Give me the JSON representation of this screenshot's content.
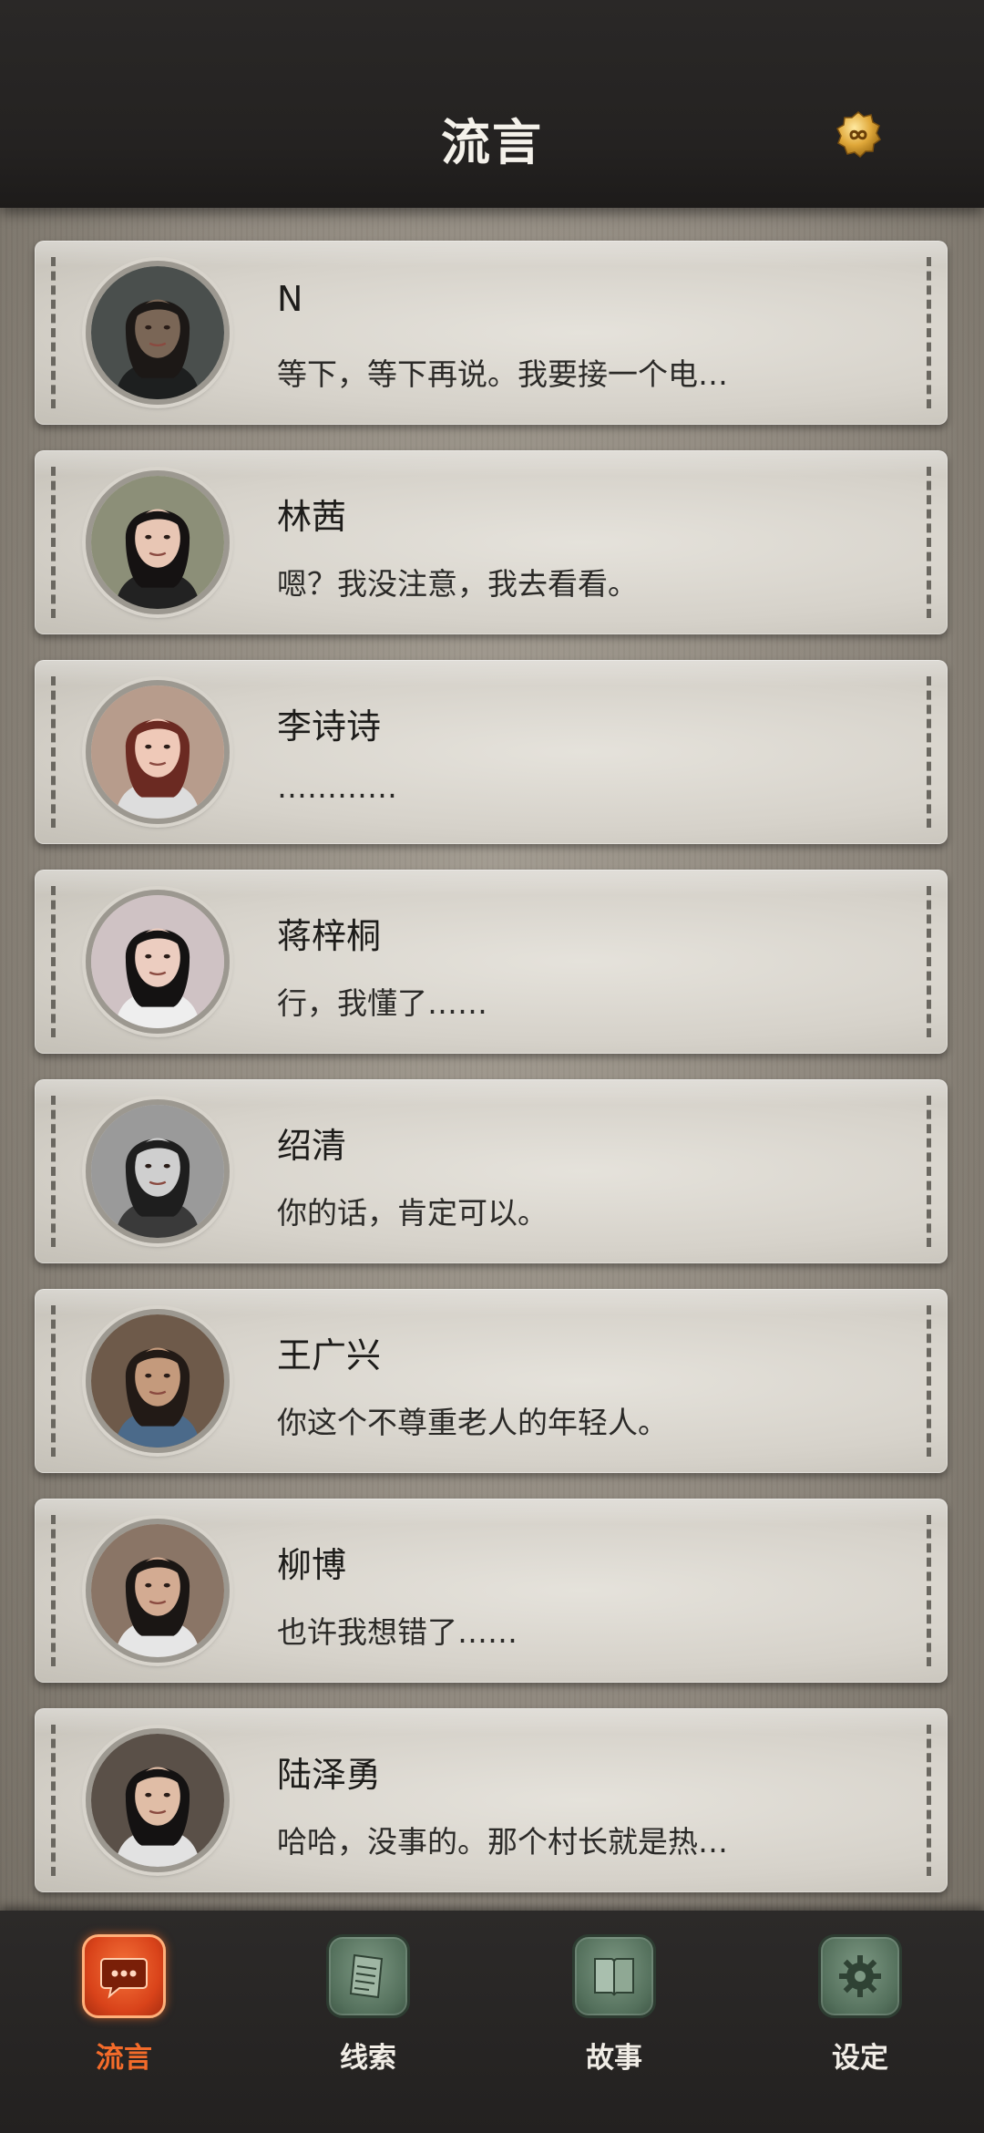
{
  "header": {
    "title": "流言",
    "badge_icon": "infinity-badge-icon"
  },
  "conversations": [
    {
      "name": "N",
      "message": "等下，等下再说。我要接一个电…",
      "avatar": {
        "skin": "#7a6656",
        "hair": "#1c1816",
        "shirt": "#1d1f1f",
        "bg": "#4a4f4d"
      }
    },
    {
      "name": "林茜",
      "message": "嗯？我没注意，我去看看。",
      "avatar": {
        "skin": "#e8c6b4",
        "hair": "#151212",
        "shirt": "#222",
        "bg": "#8c8f78"
      }
    },
    {
      "name": "李诗诗",
      "message": "…………",
      "avatar": {
        "skin": "#efc9b8",
        "hair": "#6b2a22",
        "shirt": "#ddd",
        "bg": "#b79c8c"
      }
    },
    {
      "name": "蒋梓桐",
      "message": "行，我懂了……",
      "avatar": {
        "skin": "#eccdc0",
        "hair": "#141212",
        "shirt": "#eee",
        "bg": "#cfc2c4"
      }
    },
    {
      "name": "绍清",
      "message": "你的话，肯定可以。",
      "avatar": {
        "skin": "#cfcfcf",
        "hair": "#1e1e1e",
        "shirt": "#3a3a3a",
        "bg": "#9a9a9a"
      }
    },
    {
      "name": "王广兴",
      "message": "你这个不尊重老人的年轻人。",
      "avatar": {
        "skin": "#c49a7c",
        "hair": "#221a16",
        "shirt": "#4b6a8a",
        "bg": "#6e5a4a"
      }
    },
    {
      "name": "柳博",
      "message": "也许我想错了……",
      "avatar": {
        "skin": "#d3ab92",
        "hair": "#1a1614",
        "shirt": "#e6e6e6",
        "bg": "#8a7566"
      }
    },
    {
      "name": "陆泽勇",
      "message": "哈哈，没事的。那个村长就是热…",
      "avatar": {
        "skin": "#e0bda6",
        "hair": "#141212",
        "shirt": "#e2e2e2",
        "bg": "#5a5048"
      }
    }
  ],
  "bottom_nav": {
    "items": [
      {
        "label": "流言",
        "icon": "chat-bubble-icon",
        "active": true
      },
      {
        "label": "线索",
        "icon": "paper-scroll-icon",
        "active": false
      },
      {
        "label": "故事",
        "icon": "book-icon",
        "active": false
      },
      {
        "label": "设定",
        "icon": "gear-icon",
        "active": false
      }
    ]
  },
  "colors": {
    "accent": "#f36b2a",
    "header_bg": "#262423",
    "card_bg": "#d9d5cd",
    "nav_green": "#5b7763"
  }
}
